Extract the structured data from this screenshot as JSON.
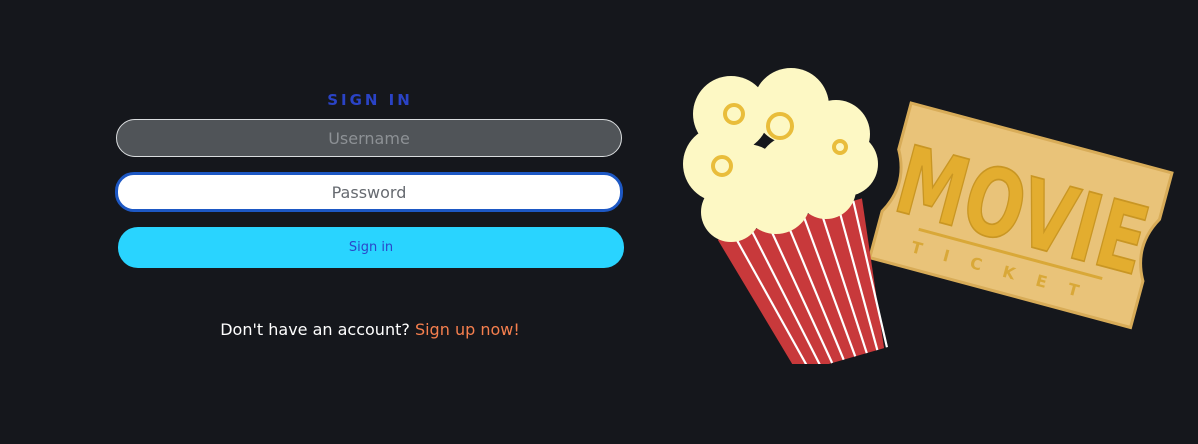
{
  "login": {
    "title": "SIGN IN",
    "username_placeholder": "Username",
    "password_placeholder": "Password",
    "signin_label": "Sign in",
    "signup_prompt": "Don't have an account?",
    "signup_link": "Sign up now!"
  },
  "illustration": {
    "ticket_title": "MOVIE",
    "ticket_subtitle": "TICKET",
    "icons": [
      "popcorn-icon",
      "movie-ticket-icon"
    ]
  },
  "colors": {
    "background": "#15171c",
    "title": "#2a43c6",
    "button": "#29d4ff",
    "link": "#f57f4e"
  }
}
